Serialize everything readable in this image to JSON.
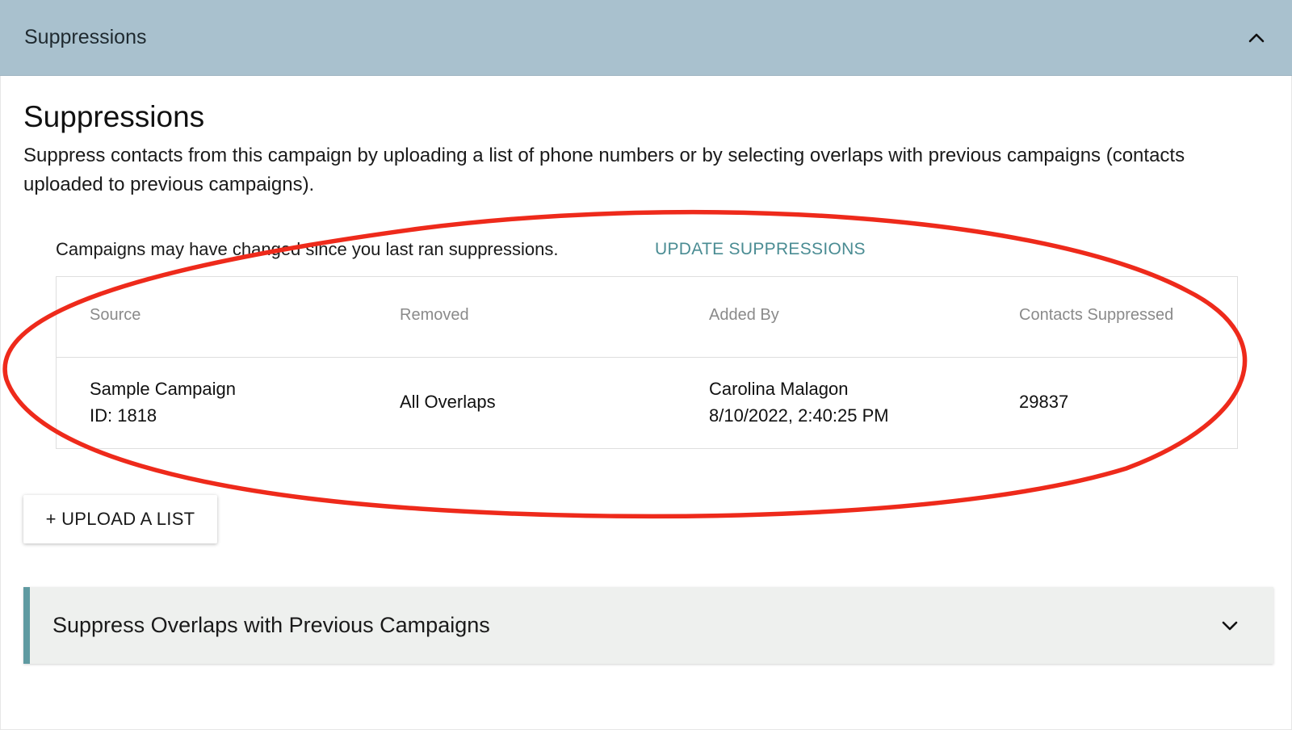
{
  "accordion": {
    "title": "Suppressions",
    "chevron_icon": "chevron-up-icon"
  },
  "section": {
    "title": "Suppressions",
    "description": "Suppress contacts from this campaign by uploading a list of phone numbers or by selecting overlaps with previous campaigns (contacts uploaded to previous campaigns)."
  },
  "notice": {
    "text": "Campaigns may have changed since you last ran suppressions.",
    "link_label": "UPDATE SUPPRESSIONS"
  },
  "table": {
    "columns": [
      "Source",
      "Removed",
      "Added By",
      "Contacts Suppressed"
    ],
    "rows": [
      {
        "source_name": "Sample Campaign",
        "source_id": "ID: 1818",
        "removed": "All Overlaps",
        "added_by_name": "Carolina Malagon",
        "added_by_date": "8/10/2022, 2:40:25 PM",
        "contacts_suppressed": "29837"
      }
    ]
  },
  "upload_button": {
    "label": "+ UPLOAD A LIST"
  },
  "overlap_accordion": {
    "title": "Suppress Overlaps with Previous Campaigns",
    "chevron_icon": "chevron-down-icon"
  },
  "colors": {
    "header_bg": "#a9c1ce",
    "link": "#4a8c93",
    "accent_bar": "#5f9aa1",
    "annotation": "#ee2a1b"
  }
}
